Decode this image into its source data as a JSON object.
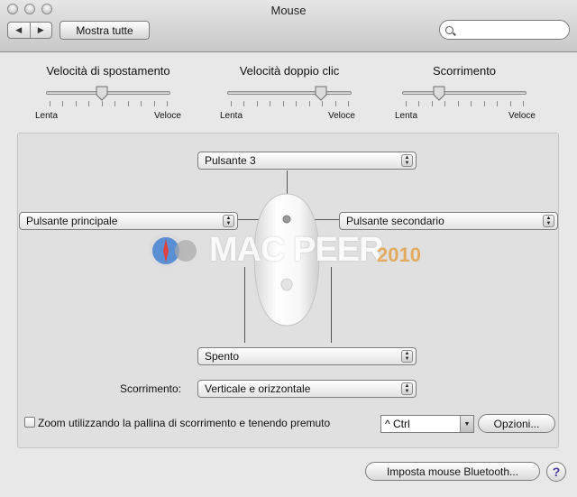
{
  "window": {
    "title": "Mouse"
  },
  "toolbar": {
    "back_glyph": "◀",
    "forward_glyph": "▶",
    "show_all_label": "Mostra tutte",
    "search_value": ""
  },
  "sliders": [
    {
      "label": "Velocità di spostamento",
      "min_label": "Lenta",
      "max_label": "Veloce",
      "value": 0.45
    },
    {
      "label": "Velocità doppio clic",
      "min_label": "Lenta",
      "max_label": "Veloce",
      "value": 0.75
    },
    {
      "label": "Scorrimento",
      "min_label": "Lenta",
      "max_label": "Veloce",
      "value": 0.3
    }
  ],
  "buttons_config": {
    "button3": "Pulsante 3",
    "primary": "Pulsante principale",
    "secondary": "Pulsante secondario",
    "squeeze": "Spento"
  },
  "scroll": {
    "label": "Scorrimento:",
    "value": "Verticale e orizzontale"
  },
  "zoom": {
    "checked": false,
    "label": "Zoom utilizzando la pallina di scorrimento e tenendo premuto",
    "modifier": "^ Ctrl",
    "options_label": "Opzioni..."
  },
  "bluetooth_button": "Imposta mouse Bluetooth...",
  "help_glyph": "?",
  "watermark": {
    "text": "MAC PEER",
    "year": "2010"
  }
}
